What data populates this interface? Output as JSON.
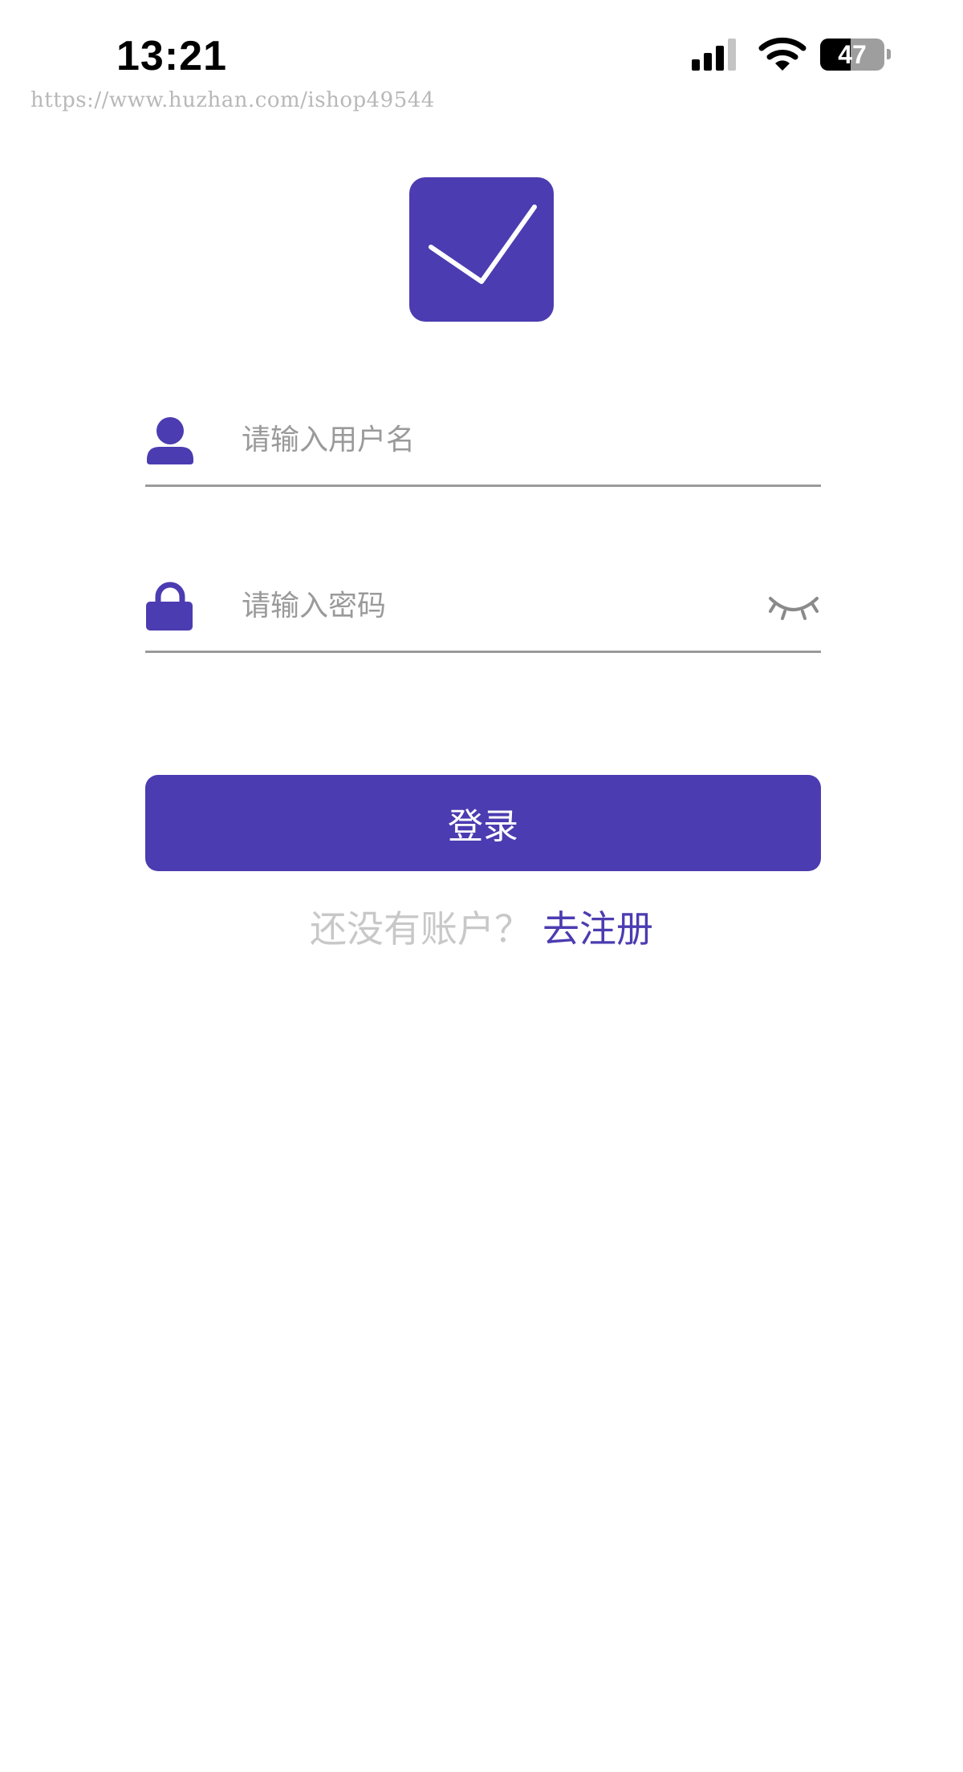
{
  "status_bar": {
    "time": "13:21",
    "battery_level": "47",
    "battery_percent": 47,
    "signal_bars_active": 3,
    "signal_bars_total": 4
  },
  "watermark": "https://www.huzhan.com/ishop49544",
  "logo": {
    "icon": "checkmark-icon",
    "color": "#4b3cb1"
  },
  "form": {
    "username": {
      "icon": "user-icon",
      "value": "",
      "placeholder": "请输入用户名"
    },
    "password": {
      "icon": "lock-icon",
      "value": "",
      "placeholder": "请输入密码",
      "toggle_icon": "eye-closed-icon"
    }
  },
  "login_button": {
    "label": "登录"
  },
  "register": {
    "prompt": "还没有账户？",
    "link": "去注册"
  },
  "colors": {
    "accent": "#4b3cb1",
    "muted_text": "#9a9a9a",
    "prompt_text": "#c8c8c8"
  }
}
